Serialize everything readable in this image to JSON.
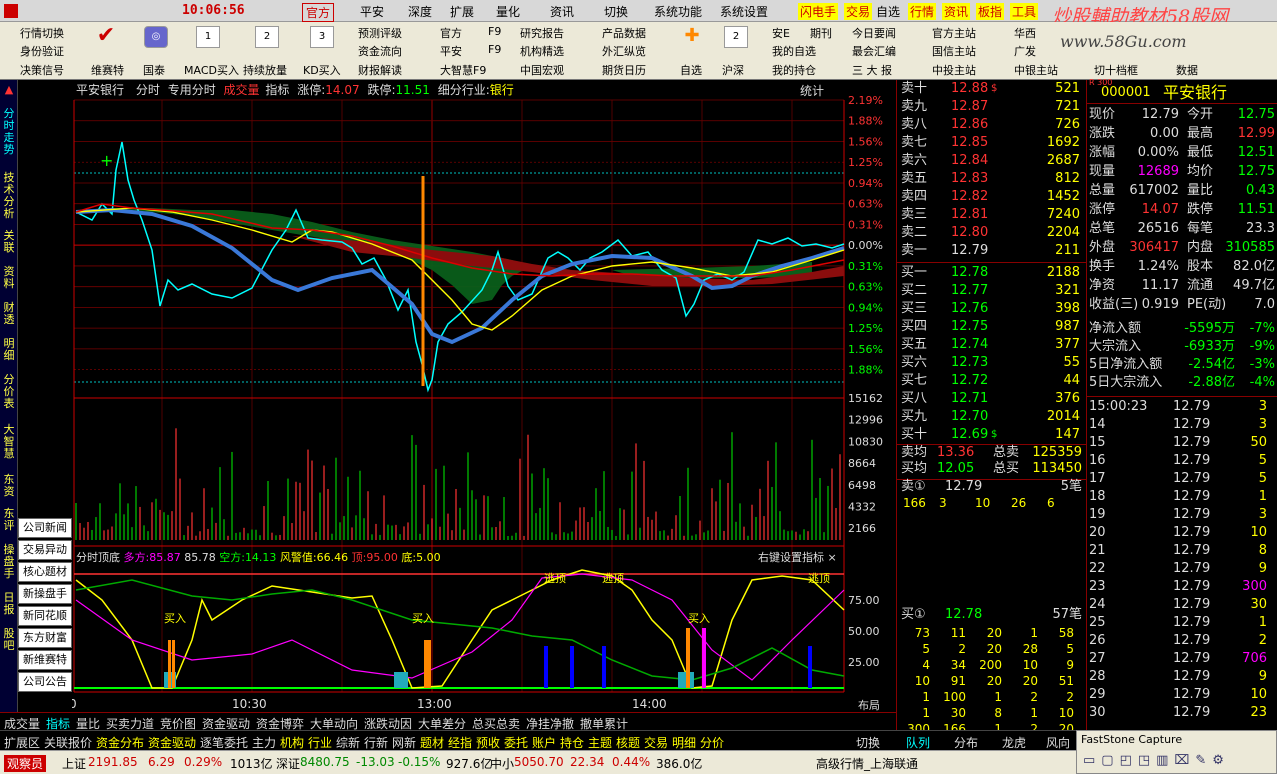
{
  "menubar": {
    "time": "10:06:56",
    "items": [
      "官方",
      "平安",
      "深度",
      "扩展",
      "量化",
      "资讯",
      "切换",
      "系统功能",
      "系统设置",
      "闪电手",
      "交易",
      "自选",
      "行情",
      "资讯",
      "板指",
      "工具"
    ],
    "watermark": "炒股輔助教材58股网",
    "watermark2": "www.58Gu.com"
  },
  "toolbar": {
    "row1": [
      "行情切换",
      "预测评级",
      "官方",
      "F9",
      "研究报告",
      "产品数据",
      "安E",
      "期刊",
      "今日要闻",
      "官方主站",
      "华西"
    ],
    "row2": [
      "身份验证",
      "资金流向",
      "平安",
      "F9",
      "机构精选",
      "外汇纵览",
      "我的自选",
      "最会汇编",
      "国信主站",
      "广发"
    ],
    "row3": [
      "决策信号",
      "维赛特",
      "国泰",
      "MACD买入",
      "持续放量",
      "KD买入",
      "财报解读",
      "大智慧F9",
      "中国宏观",
      "期货日历",
      "自选",
      "沪深",
      "我的持仓",
      "三 大 报",
      "中投主站",
      "中银主站",
      "切十档框",
      "数据"
    ],
    "icon_labels": [
      "1",
      "2",
      "3",
      "2"
    ]
  },
  "leftstrip": [
    "分时走势",
    "技术分析",
    "关联",
    "资料",
    "财透",
    "明细",
    "分价表",
    "大智慧",
    "东资",
    "东评",
    "操盘手",
    "日报",
    "股吧"
  ],
  "sidebtns": [
    "公司新闻",
    "交易异动",
    "核心题材",
    "新操盘手",
    "新同花顺",
    "东方财富",
    "新维赛特",
    "公司公告"
  ],
  "chart": {
    "header": {
      "name": "平安银行",
      "mode": "分时",
      "special": "专用分时",
      "vol": "成交量",
      "idx": "指标",
      "zt_label": "涨停:",
      "zt": "14.07",
      "dt_label": "跌停:",
      "dt": "11.51",
      "industry_label": "细分行业:",
      "industry": "银行",
      "stat": "统计"
    },
    "price_axis": [
      "13.07",
      "13.03",
      "12.99",
      "12.95",
      "12.91",
      "12.87",
      "12.83",
      "12.79",
      "12.75",
      "12.71",
      "12.67",
      "12.63",
      "12.59",
      "12.55"
    ],
    "pct_axis": [
      "2.19%",
      "1.88%",
      "1.56%",
      "1.25%",
      "0.94%",
      "0.63%",
      "0.31%",
      "0.00%",
      "0.31%",
      "0.63%",
      "0.94%",
      "1.25%",
      "1.56%",
      "1.88%"
    ],
    "vol_axis": [
      "15162",
      "12996",
      "10830",
      "8664",
      "6498",
      "4332",
      "2166"
    ],
    "ind_header": {
      "name": "分时顶底",
      "duo_label": "多方:",
      "duo": "85.87",
      "v2": "85.78",
      "kong_label": "空方:",
      "kong": "14.13",
      "warn_label": "风警值:",
      "warn": "66.46",
      "top_label": "顶:",
      "top": "95.00",
      "bot_label": "底:",
      "bot": "5.00",
      "settings": "右键设置指标 ×"
    },
    "ind_axis": [
      "75.00",
      "50.00",
      "25.00"
    ],
    "ind_labels": {
      "buy": "买入",
      "sell": "逃顶"
    },
    "time_axis": [
      "09:30",
      "10:30",
      "13:00",
      "14:00"
    ],
    "layout_btn": "布局"
  },
  "bottomtabs": [
    "成交量",
    "指标",
    "量比",
    "买卖力道",
    "竞价图",
    "资金驱动",
    "资金博弈",
    "大单动向",
    "涨跌动因",
    "大单差分",
    "总买总卖",
    "净挂净撤",
    "撤单累计"
  ],
  "bottomtabs2": [
    "扩展区",
    "关联报价",
    "资金分布",
    "资金驱动",
    "逐笔委托",
    "主力",
    "机构",
    "行业",
    "综新",
    "行新",
    "网新",
    "题材",
    "经指",
    "预收",
    "委托",
    "账户",
    "持仓",
    "主题",
    "核题",
    "交易",
    "明细",
    "分价"
  ],
  "rtabs": [
    "切换",
    "队列",
    "分布",
    "龙虎",
    "风向"
  ],
  "orderbook": {
    "sells": [
      {
        "l": "卖十",
        "p": "12.88",
        "v": "521",
        "f": "$"
      },
      {
        "l": "卖九",
        "p": "12.87",
        "v": "721"
      },
      {
        "l": "卖八",
        "p": "12.86",
        "v": "726"
      },
      {
        "l": "卖七",
        "p": "12.85",
        "v": "1692"
      },
      {
        "l": "卖六",
        "p": "12.84",
        "v": "2687"
      },
      {
        "l": "卖五",
        "p": "12.83",
        "v": "812"
      },
      {
        "l": "卖四",
        "p": "12.82",
        "v": "1452"
      },
      {
        "l": "卖三",
        "p": "12.81",
        "v": "7240"
      },
      {
        "l": "卖二",
        "p": "12.80",
        "v": "2204"
      },
      {
        "l": "卖一",
        "p": "12.79",
        "v": "211"
      }
    ],
    "buys": [
      {
        "l": "买一",
        "p": "12.78",
        "v": "2188"
      },
      {
        "l": "买二",
        "p": "12.77",
        "v": "321"
      },
      {
        "l": "买三",
        "p": "12.76",
        "v": "398"
      },
      {
        "l": "买四",
        "p": "12.75",
        "v": "987"
      },
      {
        "l": "买五",
        "p": "12.74",
        "v": "377"
      },
      {
        "l": "买六",
        "p": "12.73",
        "v": "55"
      },
      {
        "l": "买七",
        "p": "12.72",
        "v": "44"
      },
      {
        "l": "买八",
        "p": "12.71",
        "v": "376"
      },
      {
        "l": "买九",
        "p": "12.70",
        "v": "2014"
      },
      {
        "l": "买十",
        "p": "12.69",
        "v": "147",
        "f": "$"
      }
    ],
    "avg_sell_label": "卖均",
    "avg_sell": "13.36",
    "total_sell_label": "总卖",
    "total_sell": "125359",
    "avg_buy_label": "买均",
    "avg_buy": "12.05",
    "total_buy_label": "总买",
    "total_buy": "113450",
    "sell1_label": "卖①",
    "sell1_price": "12.79",
    "sell1_count": "5笔",
    "sell1_q": [
      "166",
      "3",
      "10",
      "26",
      "6"
    ],
    "buy1_label": "买①",
    "buy1_price": "12.78",
    "buy1_count": "57笔",
    "buy1_q": [
      [
        "73",
        "11",
        "20",
        "1",
        "58"
      ],
      [
        "5",
        "2",
        "20",
        "28",
        "5"
      ],
      [
        "4",
        "34",
        "200",
        "10",
        "9"
      ],
      [
        "10",
        "91",
        "20",
        "20",
        "51"
      ],
      [
        "1",
        "100",
        "1",
        "2",
        "2"
      ],
      [
        "1",
        "30",
        "8",
        "1",
        "10"
      ],
      [
        "300",
        "166",
        "1",
        "2",
        "20"
      ]
    ]
  },
  "quote": {
    "code_prefix": "R 300",
    "code": "000001",
    "name": "平安银行",
    "rows": [
      [
        "现价",
        "12.79",
        "今开",
        "12.75"
      ],
      [
        "涨跌",
        "0.00",
        "最高",
        "12.99"
      ],
      [
        "涨幅",
        "0.00%",
        "最低",
        "12.51"
      ],
      [
        "现量",
        "12689",
        "均价",
        "12.75"
      ],
      [
        "总量",
        "617002",
        "量比",
        "0.43"
      ],
      [
        "涨停",
        "14.07",
        "跌停",
        "11.51"
      ],
      [
        "总笔",
        "26516",
        "每笔",
        "23.3"
      ],
      [
        "外盘",
        "306417",
        "内盘",
        "310585"
      ],
      [
        "换手",
        "1.24%",
        "股本",
        "82.0亿"
      ],
      [
        "净资",
        "11.17",
        "流通",
        "49.7亿"
      ],
      [
        "收益(三)",
        "0.919",
        "PE(动)",
        "7.0"
      ]
    ],
    "flows": [
      [
        "净流入额",
        "-5595万",
        "-7%"
      ],
      [
        "大宗流入",
        "-6933万",
        "-9%"
      ],
      [
        "5日净流入额",
        "-2.54亿",
        "-3%"
      ],
      [
        "5日大宗流入",
        "-2.88亿",
        "-4%"
      ]
    ],
    "ticks": [
      [
        "15:00:23",
        "12.79",
        "3"
      ],
      [
        "14",
        "12.79",
        "3"
      ],
      [
        "15",
        "12.79",
        "50"
      ],
      [
        "16",
        "12.79",
        "5"
      ],
      [
        "17",
        "12.79",
        "5"
      ],
      [
        "18",
        "12.79",
        "1"
      ],
      [
        "19",
        "12.79",
        "3"
      ],
      [
        "20",
        "12.79",
        "10"
      ],
      [
        "21",
        "12.79",
        "8"
      ],
      [
        "22",
        "12.79",
        "9"
      ],
      [
        "23",
        "12.79",
        "300"
      ],
      [
        "24",
        "12.79",
        "30"
      ],
      [
        "25",
        "12.79",
        "1"
      ],
      [
        "26",
        "12.79",
        "2"
      ],
      [
        "27",
        "12.79",
        "706"
      ],
      [
        "28",
        "12.79",
        "9"
      ],
      [
        "29",
        "12.79",
        "10"
      ],
      [
        "30",
        "12.79",
        "23"
      ]
    ]
  },
  "status": {
    "role": "观察员",
    "sh_label": "上证",
    "sh": "2191.85",
    "sh_chg": "6.29",
    "sh_pct": "0.29%",
    "sh_amt": "1013亿",
    "sz_label": "深证",
    "sz": "8480.75",
    "sz_chg": "-13.03",
    "sz_pct": "-0.15%",
    "sz_amt": "927.6亿",
    "zx_label": "中小",
    "zx": "5050.70",
    "zx_chg": "22.34",
    "zx_pct": "0.44%",
    "zx_amt": "386.0亿",
    "server": "高级行情_上海联通",
    "capture": "FastStone Capture"
  },
  "colors": {
    "up": "#ff3333",
    "down": "#00ff00",
    "accent": "#ffff00",
    "grid": "#800000"
  }
}
